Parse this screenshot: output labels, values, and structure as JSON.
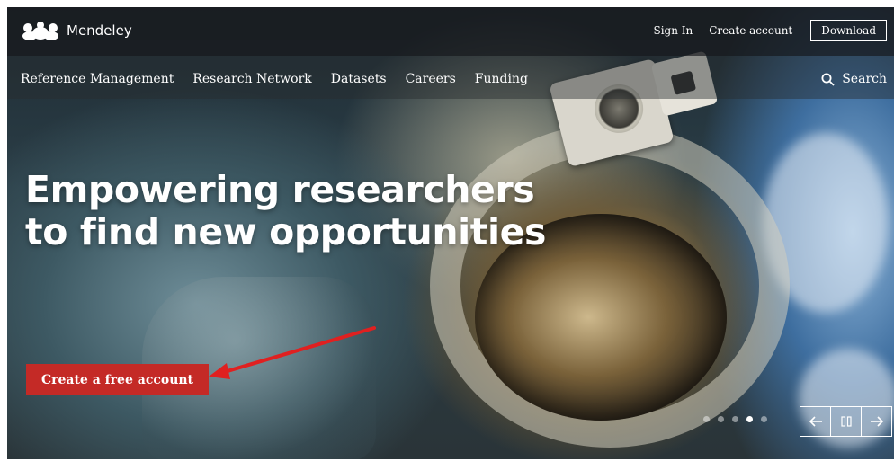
{
  "brand": {
    "name": "Mendeley",
    "logo_icon": "mendeley-logo-icon"
  },
  "header": {
    "sign_in": "Sign In",
    "create_account": "Create account",
    "download": "Download"
  },
  "nav": {
    "items": [
      {
        "label": "Reference Management"
      },
      {
        "label": "Research Network"
      },
      {
        "label": "Datasets"
      },
      {
        "label": "Careers"
      },
      {
        "label": "Funding"
      }
    ],
    "search_label": "Search",
    "search_icon": "search-icon"
  },
  "hero": {
    "headline_line1": "Empowering researchers",
    "headline_line2": "to find new opportunities",
    "cta_label": "Create a free account",
    "carousel": {
      "slide_count": 5,
      "active_index": 3
    },
    "controls": {
      "prev_icon": "arrow-left-icon",
      "pause_icon": "pause-icon",
      "next_icon": "arrow-right-icon"
    }
  },
  "colors": {
    "cta": "#c42a26",
    "annotation_arrow": "#e02020",
    "topbar": "#191b1e"
  }
}
